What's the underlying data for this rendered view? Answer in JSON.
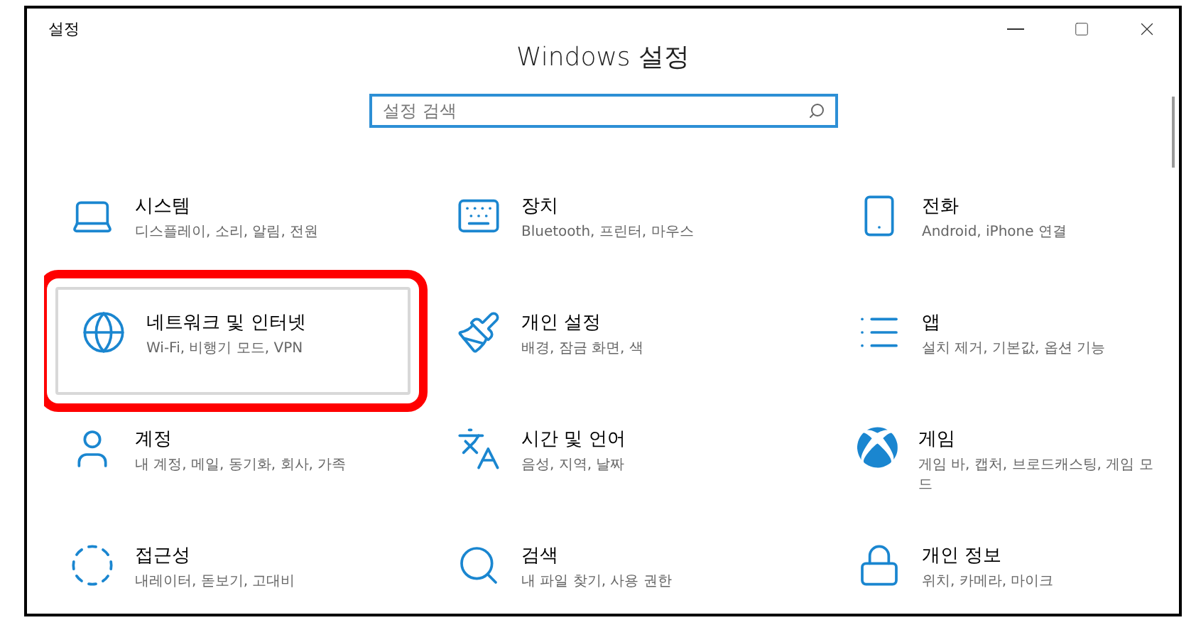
{
  "window": {
    "title": "설정",
    "heading": "Windows 설정"
  },
  "search": {
    "placeholder": "설정 검색"
  },
  "tiles": [
    {
      "kind": "laptop",
      "title": "시스템",
      "description": "디스플레이, 소리, 알림, 전원",
      "selected": false,
      "highlighted": false
    },
    {
      "kind": "keyboard",
      "title": "장치",
      "description": "Bluetooth, 프린터, 마우스",
      "selected": false,
      "highlighted": false
    },
    {
      "kind": "phone",
      "title": "전화",
      "description": "Android, iPhone 연결",
      "selected": false,
      "highlighted": false
    },
    {
      "kind": "globe",
      "title": "네트워크 및 인터넷",
      "description": "Wi-Fi, 비행기 모드, VPN",
      "selected": true,
      "highlighted": true
    },
    {
      "kind": "brush",
      "title": "개인 설정",
      "description": "배경, 잠금 화면, 색",
      "selected": false,
      "highlighted": false
    },
    {
      "kind": "list",
      "title": "앱",
      "description": "설치 제거, 기본값, 옵션 기능",
      "selected": false,
      "highlighted": false
    },
    {
      "kind": "user",
      "title": "계정",
      "description": "내 계정, 메일, 동기화, 회사, 가족",
      "selected": false,
      "highlighted": false
    },
    {
      "kind": "language",
      "title": "시간 및 언어",
      "description": "음성, 지역, 날짜",
      "selected": false,
      "highlighted": false
    },
    {
      "kind": "xbox",
      "title": "게임",
      "description": "게임 바, 캡처, 브로드캐스팅, 게임 모드",
      "selected": false,
      "highlighted": false
    },
    {
      "kind": "access",
      "title": "접근성",
      "description": "내레이터, 돋보기, 고대비",
      "selected": false,
      "highlighted": false
    },
    {
      "kind": "search",
      "title": "검색",
      "description": "내 파일 찾기, 사용 권한",
      "selected": false,
      "highlighted": false
    },
    {
      "kind": "lock",
      "title": "개인 정보",
      "description": "위치, 카메라, 마이크",
      "selected": false,
      "highlighted": false
    }
  ]
}
